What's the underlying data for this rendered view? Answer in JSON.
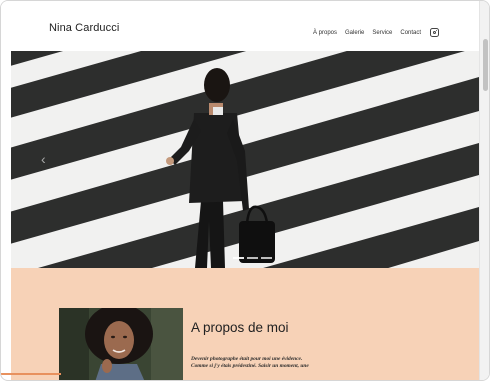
{
  "header": {
    "brand": "Nina Carducci",
    "nav": [
      {
        "label": "À propos"
      },
      {
        "label": "Galerie"
      },
      {
        "label": "Service"
      },
      {
        "label": "Contact"
      }
    ],
    "social_icon": "instagram-icon"
  },
  "hero": {
    "prev_icon": "chevron-left-icon",
    "prev_glyph": "‹",
    "active_indicator": 0,
    "indicator_count": 3
  },
  "about": {
    "title": "A propos de moi",
    "text_lines": [
      "Devenir photographe était pour moi une évidence.",
      "Comme si j'y étais prédestiné. Saisir un moment, une"
    ]
  },
  "colors": {
    "about_bg": "#f7d2b7",
    "accent": "#e8915e"
  }
}
